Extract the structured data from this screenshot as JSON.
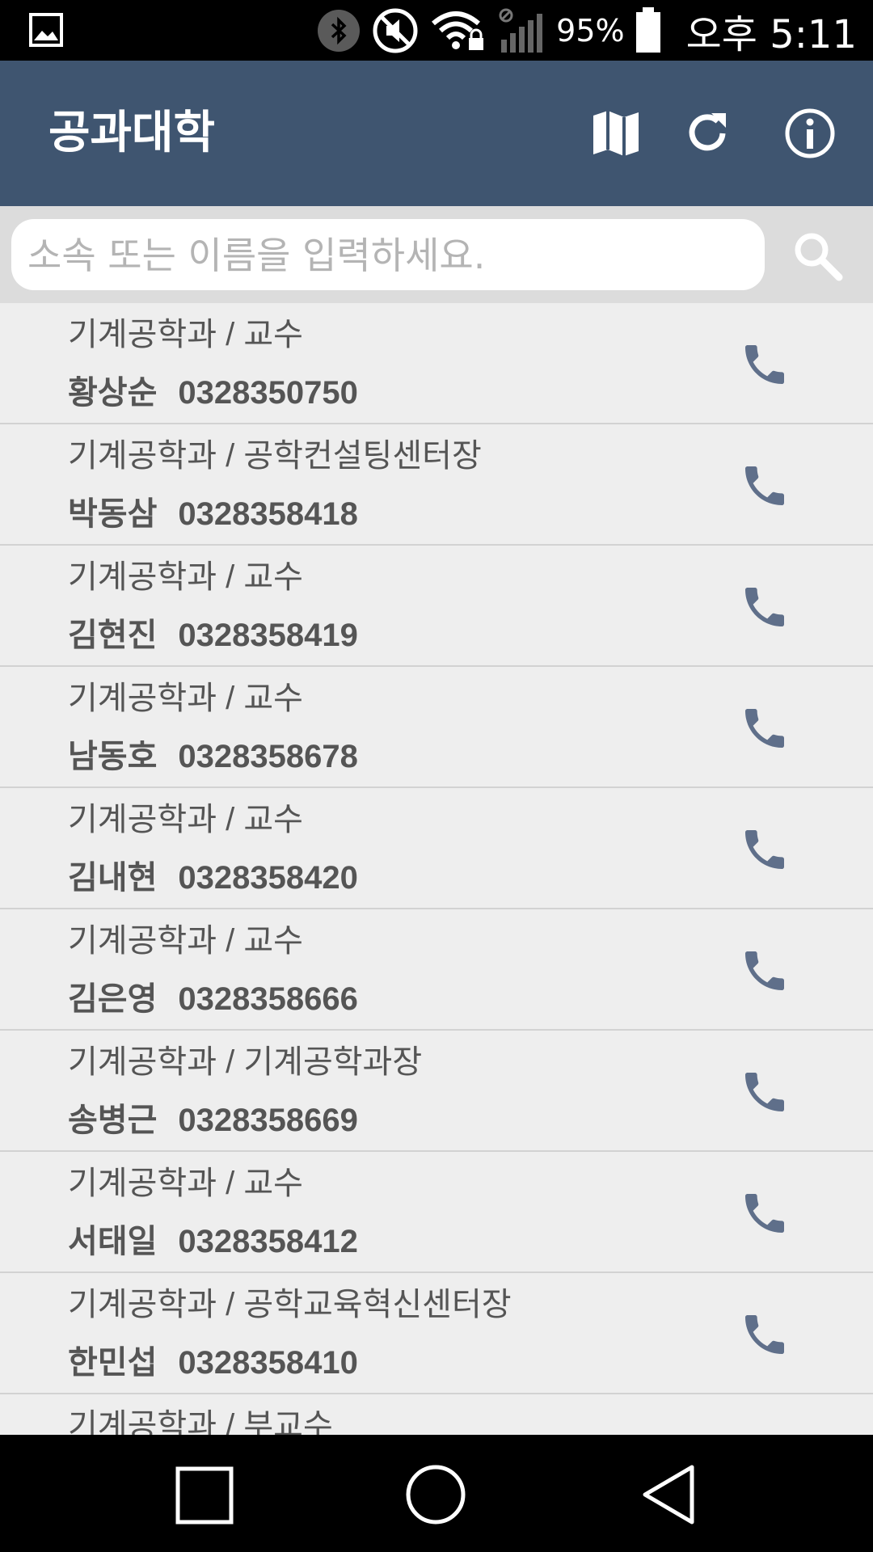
{
  "status_bar": {
    "battery_percent": "95%",
    "time": "오후 5:11"
  },
  "app_bar": {
    "title": "공과대학",
    "actions": [
      "map-icon",
      "refresh-icon",
      "info-icon"
    ]
  },
  "search": {
    "value": "",
    "placeholder": "소속 또는 이름을 입력하세요."
  },
  "contacts": [
    {
      "dept": "기계공학과 / 교수",
      "name": "황상순",
      "phone": "0328350750"
    },
    {
      "dept": "기계공학과 / 공학컨설팅센터장",
      "name": "박동삼",
      "phone": "0328358418"
    },
    {
      "dept": "기계공학과 / 교수",
      "name": "김현진",
      "phone": "0328358419"
    },
    {
      "dept": "기계공학과 / 교수",
      "name": "남동호",
      "phone": "0328358678"
    },
    {
      "dept": "기계공학과 / 교수",
      "name": "김내현",
      "phone": "0328358420"
    },
    {
      "dept": "기계공학과 / 교수",
      "name": "김은영",
      "phone": "0328358666"
    },
    {
      "dept": "기계공학과 / 기계공학과장",
      "name": "송병근",
      "phone": "0328358669"
    },
    {
      "dept": "기계공학과 / 교수",
      "name": "서태일",
      "phone": "0328358412"
    },
    {
      "dept": "기계공학과 / 공학교육혁신센터장",
      "name": "한민섭",
      "phone": "0328358410"
    },
    {
      "dept": "기계공학과 / 부교수",
      "name": "",
      "phone": ""
    }
  ],
  "colors": {
    "app_bar": "#3f5570",
    "call_icon": "#5f6f8a",
    "list_bg": "#eeeeee"
  }
}
